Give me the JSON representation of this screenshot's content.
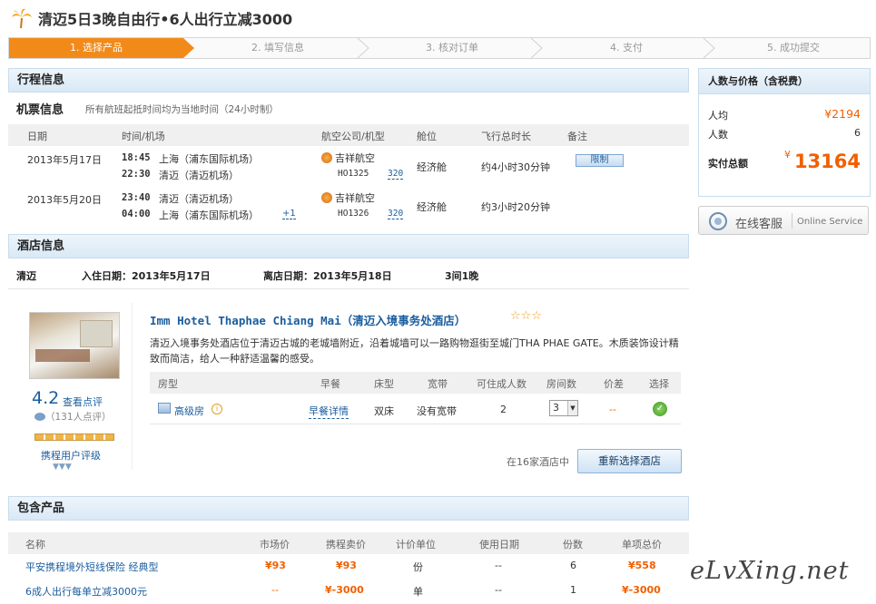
{
  "page": {
    "title": "清迈5日3晚自由行•6人出行立减3000"
  },
  "steps": [
    {
      "label": "1. 选择产品",
      "active": true
    },
    {
      "label": "2. 填写信息",
      "active": false
    },
    {
      "label": "3. 核对订单",
      "active": false
    },
    {
      "label": "4. 支付",
      "active": false
    },
    {
      "label": "5. 成功提交",
      "active": false
    }
  ],
  "trip": {
    "section_title": "行程信息",
    "flight_title": "机票信息",
    "flight_note": "所有航班起抵时间均为当地时间（24小时制）",
    "columns": [
      "日期",
      "时间/机场",
      "航空公司/机型",
      "舱位",
      "飞行总时长",
      "备注"
    ],
    "flights": [
      {
        "date": "2013年5月17日",
        "dep_time": "18:45",
        "dep_airport": "上海（浦东国际机场）",
        "arr_time": "22:30",
        "arr_airport": "清迈（清迈机场）",
        "arr_plus": "",
        "airline": "吉祥航空",
        "flight_no": "HO1325",
        "aircraft": "320",
        "cabin": "经济舱",
        "duration": "约4小时30分钟",
        "remark": "限制"
      },
      {
        "date": "2013年5月20日",
        "dep_time": "23:40",
        "dep_airport": "清迈（清迈机场）",
        "arr_time": "04:00",
        "arr_airport": "上海（浦东国际机场）",
        "arr_plus": "+1",
        "airline": "吉祥航空",
        "flight_no": "HO1326",
        "aircraft": "320",
        "cabin": "经济舱",
        "duration": "约3小时20分钟",
        "remark": ""
      }
    ]
  },
  "hotel": {
    "section_title": "酒店信息",
    "city": "清迈",
    "checkin": "入住日期：2013年5月17日",
    "checkout": "离店日期：2013年5月18日",
    "nights": "3间1晚",
    "name": "Imm Hotel Thaphae Chiang Mai（清迈入境事务处酒店）",
    "stars": "☆☆☆",
    "description": "清迈入境事务处酒店位于清迈古城的老城墙附近，沿着城墙可以一路购物逛街至城门THA PHAE GATE。木质装饰设计精致而简洁，给人一种舒适温馨的感受。",
    "score": "4.2",
    "score_link": "查看点评",
    "review_count": "（131人点评）",
    "user_level": "携程用户评级",
    "room_columns": [
      "房型",
      "早餐",
      "床型",
      "宽带",
      "可住成人数",
      "房间数",
      "价差",
      "选择"
    ],
    "room": {
      "type": "高级房",
      "breakfast": "早餐详情",
      "bed": "双床",
      "broadband": "没有宽带",
      "adults": "2",
      "rooms": "3",
      "diff": "--"
    },
    "choose_note": "在16家酒店中",
    "rechoose_label": "重新选择酒店"
  },
  "products": {
    "section_title": "包含产品",
    "columns": [
      "名称",
      "市场价",
      "携程卖价",
      "计价单位",
      "使用日期",
      "份数",
      "单项总价"
    ],
    "rows": [
      {
        "name": "平安携程境外短线保险 经典型",
        "market": "¥93",
        "price": "¥93",
        "unit": "份",
        "date": "--",
        "qty": "6",
        "total": "¥558"
      },
      {
        "name": "6成人出行每单立减3000元",
        "market": "--",
        "price": "¥-3000",
        "unit": "单",
        "date": "--",
        "qty": "1",
        "total": "¥-3000"
      }
    ]
  },
  "price_box": {
    "title": "人数与价格（含税费）",
    "per_person_label": "人均",
    "per_person_value": "¥2194",
    "people_label": "人数",
    "people_value": "6",
    "total_label": "实付总额",
    "currency": "¥",
    "total_value": "13164"
  },
  "service": {
    "label_cn": "在线客服",
    "label_en": "Online Service"
  },
  "watermark": "eLvXing.net"
}
